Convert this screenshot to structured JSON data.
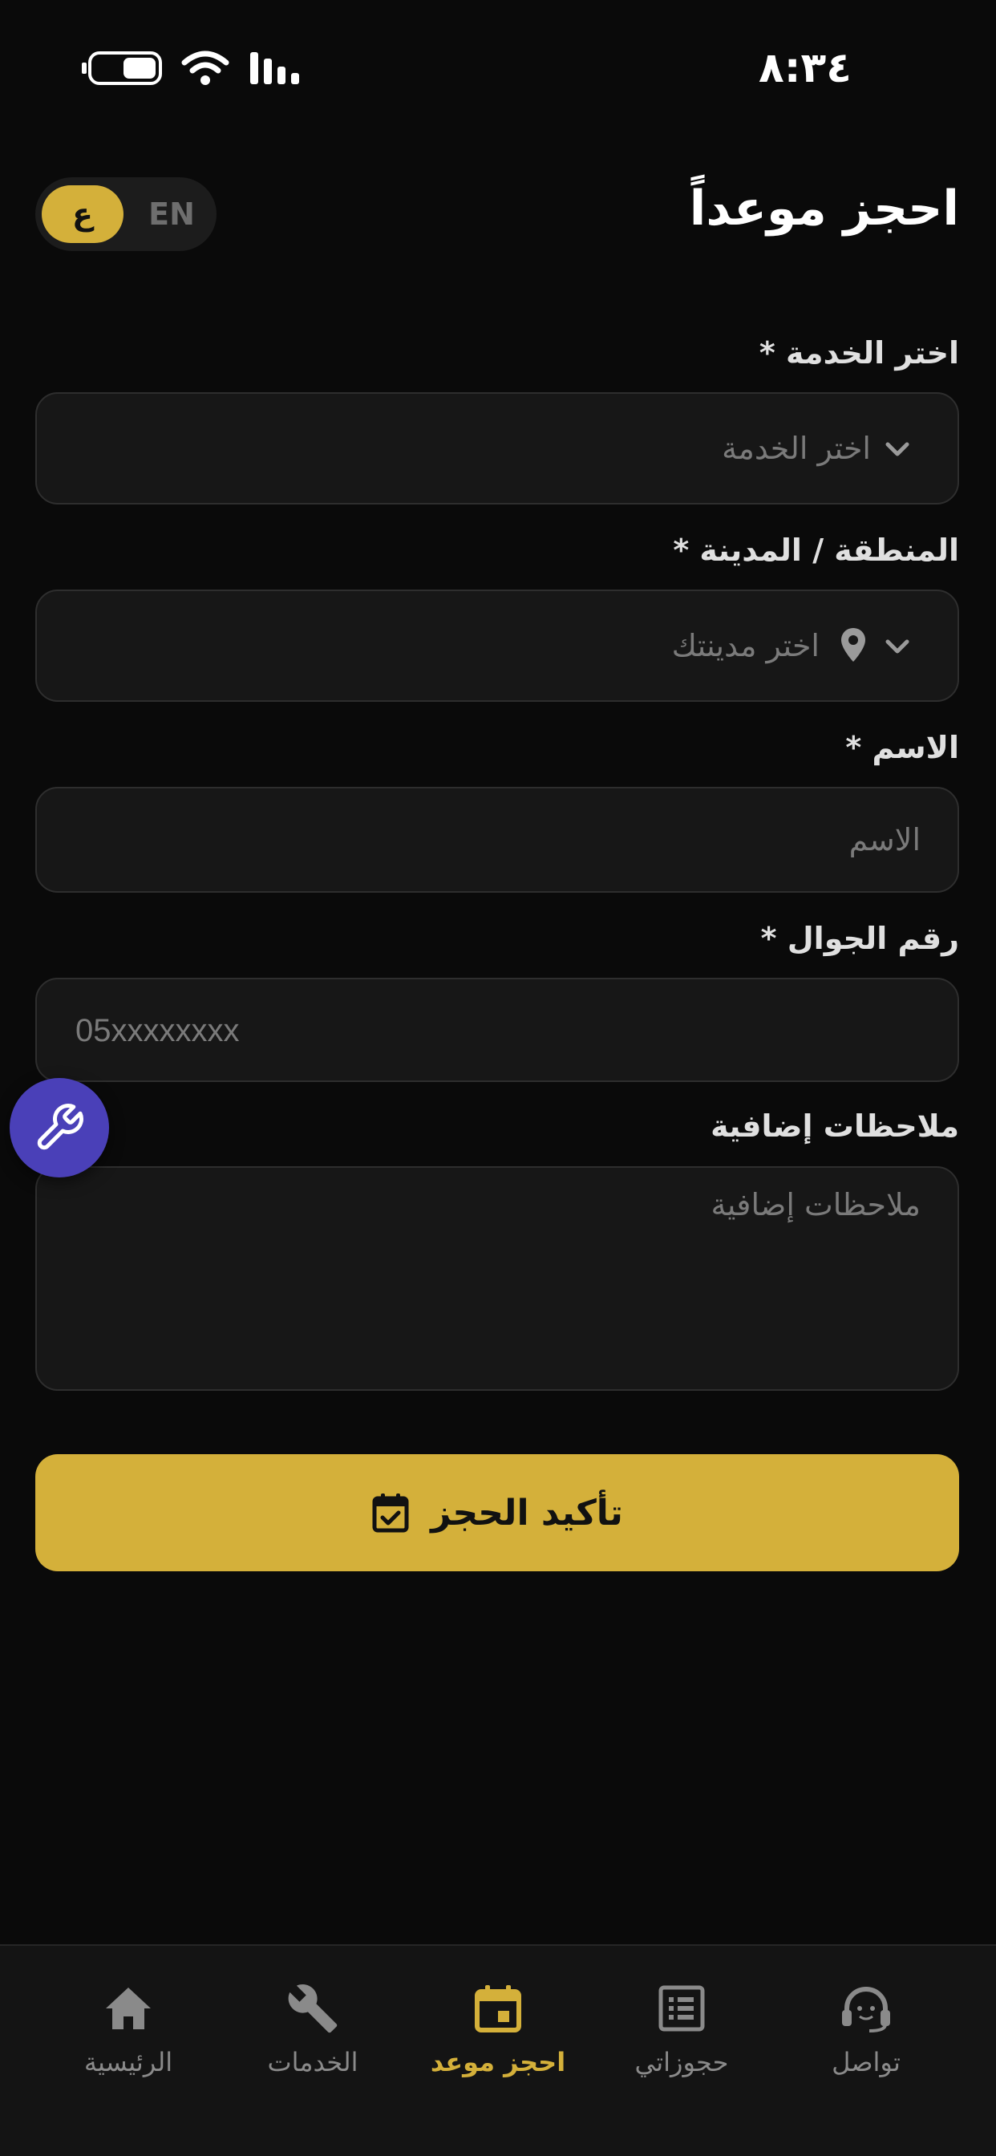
{
  "status_bar": {
    "time": "٨:٣٤"
  },
  "header": {
    "title": "احجز موعداً",
    "lang_en": "EN",
    "lang_ar": "ع"
  },
  "form": {
    "service": {
      "label": "اختر الخدمة *",
      "placeholder": "اختر الخدمة"
    },
    "city": {
      "label": "المنطقة / المدينة *",
      "placeholder": "اختر مدينتك"
    },
    "name": {
      "label": "الاسم *",
      "placeholder": "الاسم"
    },
    "phone": {
      "label": "رقم الجوال *",
      "placeholder": "05xxxxxxxx"
    },
    "notes": {
      "label": "ملاحظات إضافية",
      "placeholder": "ملاحظات إضافية"
    },
    "confirm_label": "تأكيد الحجز"
  },
  "bottom_nav": {
    "items": [
      {
        "label": "الرئيسية",
        "icon": "home-icon"
      },
      {
        "label": "الخدمات",
        "icon": "wrench-icon"
      },
      {
        "label": "احجز موعد",
        "icon": "calendar-icon"
      },
      {
        "label": "حجوزاتي",
        "icon": "list-icon"
      },
      {
        "label": "تواصل",
        "icon": "headset-icon"
      }
    ],
    "active_index": 2
  },
  "colors": {
    "background": "#0a0a0a",
    "accent": "#d4b03a",
    "fab": "#4a40b8",
    "field_bg": "#171717"
  }
}
